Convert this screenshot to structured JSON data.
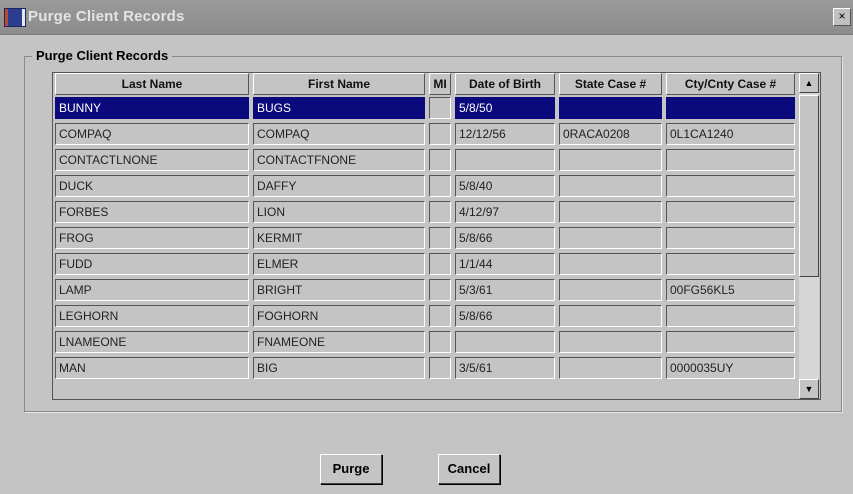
{
  "window": {
    "title": "Purge Client Records",
    "close_glyph": "×"
  },
  "group": {
    "label": "Purge Client Records"
  },
  "columns": [
    "Last Name",
    "First Name",
    "MI",
    "Date of Birth",
    "State Case #",
    "Cty/Cnty Case #"
  ],
  "rows": [
    {
      "last": "BUNNY",
      "first": "BUGS",
      "mi": "",
      "dob": "5/8/50",
      "state_case": "",
      "cty_case": ""
    },
    {
      "last": "COMPAQ",
      "first": "COMPAQ",
      "mi": "",
      "dob": "12/12/56",
      "state_case": "0RACA0208",
      "cty_case": "0L1CA1240"
    },
    {
      "last": "CONTACTLNONE",
      "first": "CONTACTFNONE",
      "mi": "",
      "dob": "",
      "state_case": "",
      "cty_case": ""
    },
    {
      "last": "DUCK",
      "first": "DAFFY",
      "mi": "",
      "dob": "5/8/40",
      "state_case": "",
      "cty_case": ""
    },
    {
      "last": "FORBES",
      "first": "LION",
      "mi": "",
      "dob": "4/12/97",
      "state_case": "",
      "cty_case": ""
    },
    {
      "last": "FROG",
      "first": "KERMIT",
      "mi": "",
      "dob": "5/8/66",
      "state_case": "",
      "cty_case": ""
    },
    {
      "last": "FUDD",
      "first": "ELMER",
      "mi": "",
      "dob": "1/1/44",
      "state_case": "",
      "cty_case": ""
    },
    {
      "last": "LAMP",
      "first": "BRIGHT",
      "mi": "",
      "dob": "5/3/61",
      "state_case": "",
      "cty_case": "00FG56KL5"
    },
    {
      "last": "LEGHORN",
      "first": "FOGHORN",
      "mi": "",
      "dob": "5/8/66",
      "state_case": "",
      "cty_case": ""
    },
    {
      "last": "LNAMEONE",
      "first": "FNAMEONE",
      "mi": "",
      "dob": "",
      "state_case": "",
      "cty_case": ""
    },
    {
      "last": "MAN",
      "first": "BIG",
      "mi": "",
      "dob": "3/5/61",
      "state_case": "",
      "cty_case": "0000035UY"
    }
  ],
  "selected_row": 0,
  "scrollbar": {
    "up_icon": "▲",
    "down_icon": "▼"
  },
  "buttons": {
    "purge": "Purge",
    "cancel": "Cancel"
  },
  "colors": {
    "selection": "#0a0a7c",
    "background": "#c4c4c4",
    "title_bar": "#8c8c8c"
  }
}
